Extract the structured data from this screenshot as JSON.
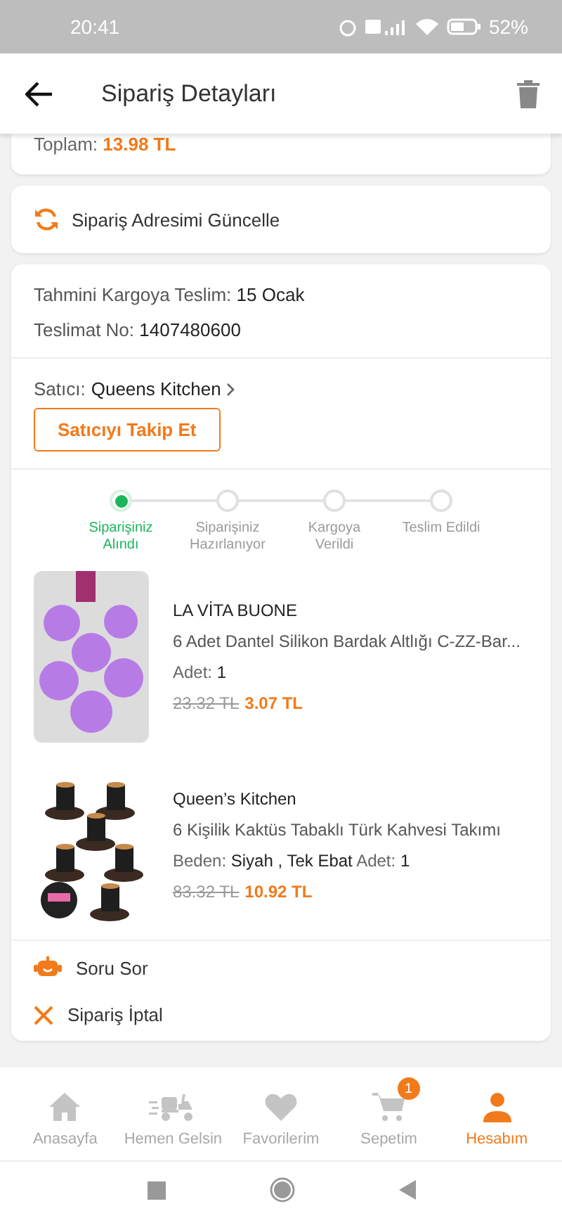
{
  "status_bar": {
    "time": "20:41",
    "battery": "52%"
  },
  "header": {
    "title": "Sipariş Detayları"
  },
  "order_total": {
    "label": "Toplam:",
    "value": "13.98 TL"
  },
  "address_button": {
    "label": "Sipariş Adresimi Güncelle"
  },
  "shipping": [
    {
      "label": "Tahmini Kargoya Teslim:",
      "value": "15 Ocak"
    },
    {
      "label": "Teslimat No:",
      "value": "1407480600"
    }
  ],
  "seller": {
    "label": "Satıcı:",
    "name": "Queens Kitchen",
    "follow_button": "Satıcıyı Takip Et"
  },
  "steps": [
    {
      "label": "Siparişiniz Alındı",
      "completed": true
    },
    {
      "label": "Siparişiniz Hazırlanıyor",
      "completed": false
    },
    {
      "label": "Kargoya Verildi",
      "completed": false
    },
    {
      "label": "Teslim Edildi",
      "completed": false
    }
  ],
  "products": [
    {
      "brand": "LA VİTA BUONE",
      "title": "6 Adet Dantel Silikon Bardak Altlığı C-ZZ-Bar...",
      "details": [
        {
          "label": "Adet:",
          "value": "1"
        }
      ],
      "old_price": "23.32 TL",
      "price": "3.07 TL"
    },
    {
      "brand": "Queen’s Kitchen",
      "title": "6 Kişilik Kaktüs Tabaklı Türk Kahvesi Takımı",
      "details": [
        {
          "label": "Beden:",
          "value": "Siyah , Tek Ebat"
        },
        {
          "label": "Adet:",
          "value": "1"
        }
      ],
      "old_price": "83.32 TL",
      "price": "10.92 TL"
    }
  ],
  "actions": [
    {
      "kind": "question",
      "label": "Soru Sor"
    },
    {
      "kind": "cancel",
      "label": "Sipariş İptal"
    }
  ],
  "tabs": [
    {
      "kind": "home",
      "label": "Anasayfa",
      "selected": false
    },
    {
      "kind": "delivery",
      "label": "Hemen Gelsin",
      "selected": false
    },
    {
      "kind": "favorites",
      "label": "Favorilerim",
      "selected": false
    },
    {
      "kind": "cart",
      "label": "Sepetim",
      "selected": false,
      "badge": "1"
    },
    {
      "kind": "account",
      "label": "Hesabım",
      "selected": true
    }
  ]
}
